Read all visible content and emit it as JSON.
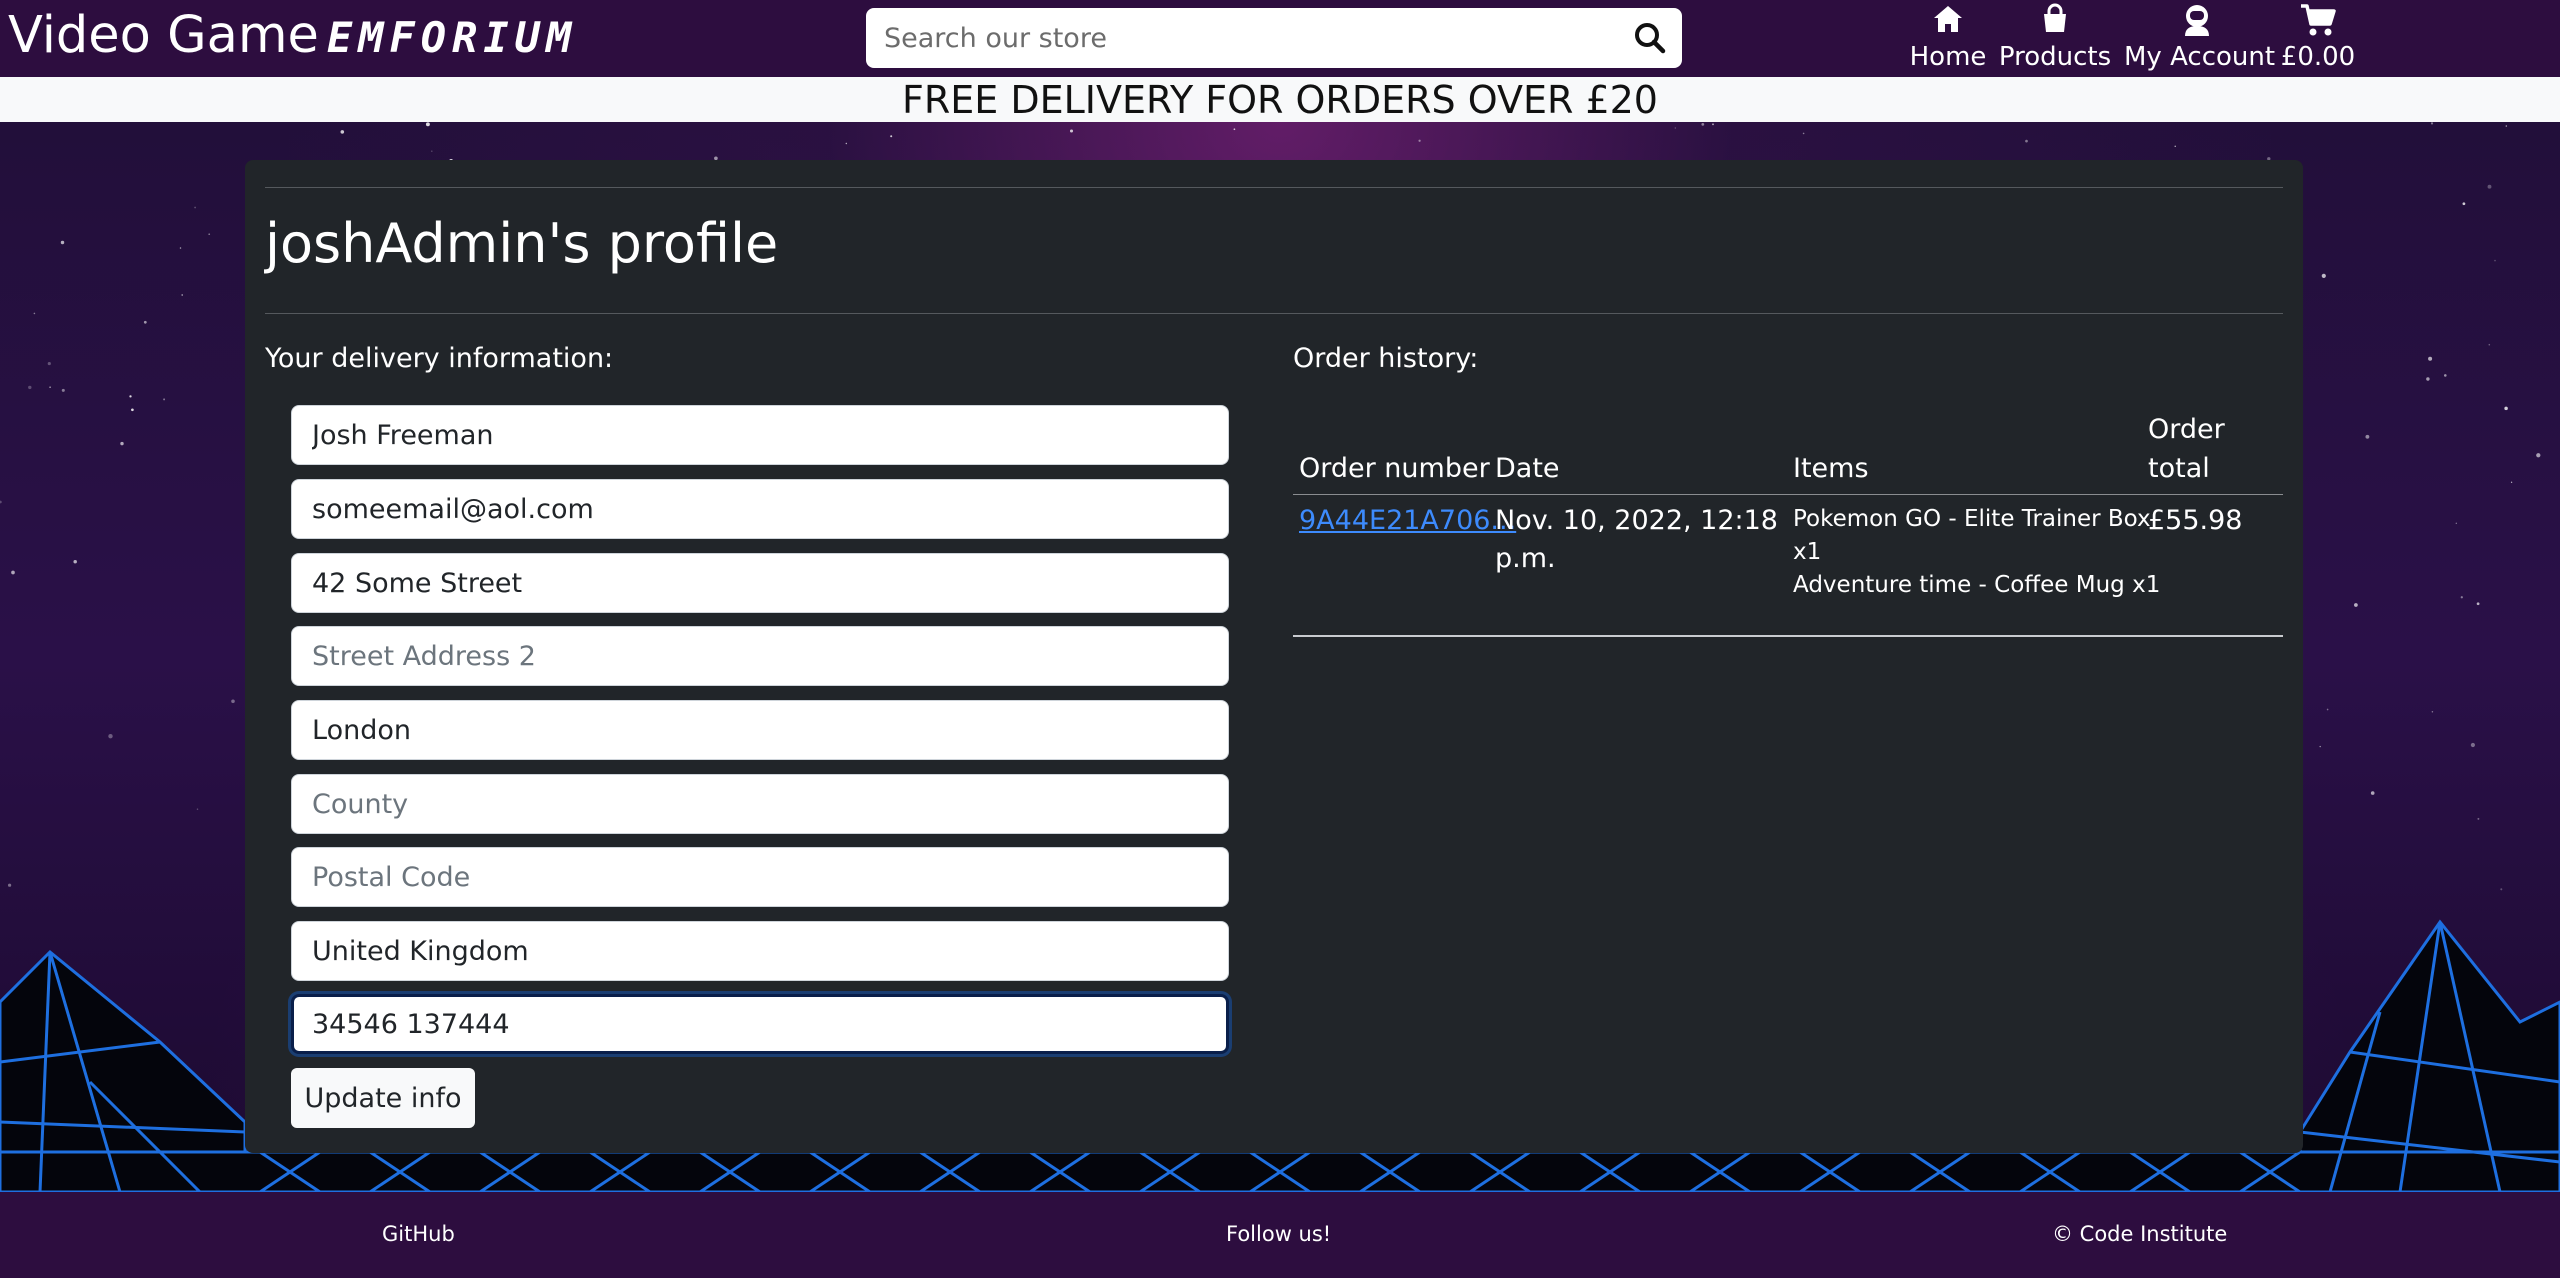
{
  "header": {
    "logo_main": "Video Game",
    "logo_accent": "EMFORIUM",
    "search_placeholder": "Search our store",
    "nav": [
      {
        "label": "Home",
        "icon": "home-icon"
      },
      {
        "label": "Products",
        "icon": "shopping-bag-icon"
      },
      {
        "label": "My Account",
        "icon": "user-astronaut-icon"
      },
      {
        "label": "£0.00",
        "icon": "cart-icon"
      }
    ]
  },
  "banner": {
    "text": "FREE DELIVERY FOR ORDERS OVER £20"
  },
  "profile": {
    "title": "joshAdmin's profile",
    "delivery_label": "Your delivery information:",
    "fields": {
      "full_name": {
        "value": "Josh Freeman",
        "placeholder": ""
      },
      "email": {
        "value": "someemail@aol.com",
        "placeholder": ""
      },
      "street1": {
        "value": "42 Some Street",
        "placeholder": ""
      },
      "street2": {
        "value": "",
        "placeholder": "Street Address 2"
      },
      "town": {
        "value": "London",
        "placeholder": ""
      },
      "county": {
        "value": "",
        "placeholder": "County"
      },
      "postcode": {
        "value": "",
        "placeholder": "Postal Code"
      },
      "country": {
        "value": "United Kingdom",
        "placeholder": ""
      },
      "phone": {
        "value": "34546 137444",
        "placeholder": ""
      }
    },
    "update_button": "Update info"
  },
  "orders": {
    "label": "Order history:",
    "columns": {
      "number": "Order number",
      "date": "Date",
      "items": "Items",
      "total_line1": "Order",
      "total_line2": "total"
    },
    "rows": [
      {
        "number": "9A44E21A706...",
        "date_line1": "Nov. 10, 2022, 12:18",
        "date_line2": "p.m.",
        "item1_line1": "Pokemon GO - Elite Trainer Box",
        "item1_line2": "x1",
        "item2": "Adventure time - Coffee Mug x1",
        "total": "£55.98"
      }
    ]
  },
  "footer": {
    "github": "GitHub",
    "follow": "Follow us!",
    "copyright": "© Code Institute"
  },
  "colors": {
    "header_bg": "#2d0d3f",
    "card_bg": "#212529",
    "link": "#3d8bfd",
    "grid_blue": "#1e6fe0"
  }
}
